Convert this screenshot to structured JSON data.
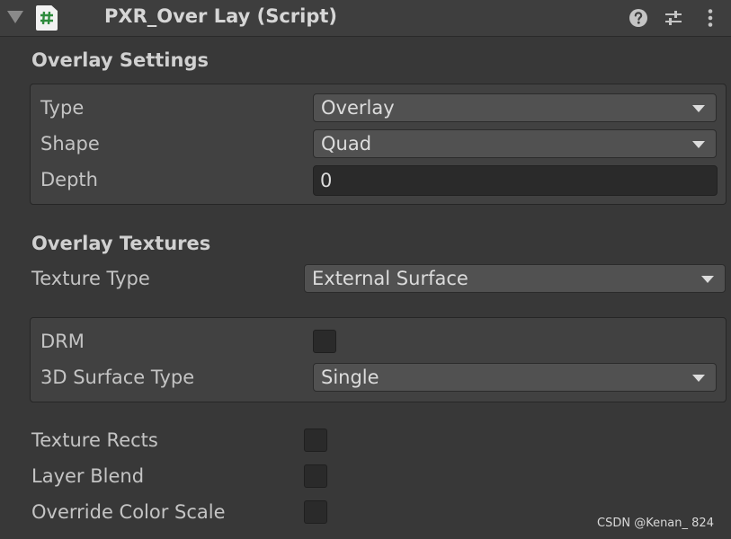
{
  "header": {
    "title": "PXR_Over Lay (Script)",
    "script_icon_glyph": "#",
    "icons": [
      "foldout-arrow-icon",
      "script-icon",
      "help-icon",
      "preset-sliders-icon",
      "kebab-menu-icon"
    ]
  },
  "overlay_settings": {
    "title": "Overlay Settings",
    "type_label": "Type",
    "type_value": "Overlay",
    "shape_label": "Shape",
    "shape_value": "Quad",
    "depth_label": "Depth",
    "depth_value": "0"
  },
  "overlay_textures": {
    "title": "Overlay Textures",
    "texture_type_label": "Texture Type",
    "texture_type_value": "External Surface",
    "drm_label": "DRM",
    "drm_checked": false,
    "surface_type_label": "3D Surface Type",
    "surface_type_value": "Single",
    "texture_rects_label": "Texture Rects",
    "texture_rects_checked": false,
    "layer_blend_label": "Layer Blend",
    "layer_blend_checked": false,
    "override_color_scale_label": "Override Color Scale",
    "override_color_scale_checked": false
  },
  "watermark": "CSDN @Kenan_ 824",
  "colors": {
    "background": "#383838",
    "header": "#3e3e3e",
    "group_box": "#414141",
    "dropdown": "#515151",
    "input": "#2a2a2a",
    "text": "#c8c8c8"
  }
}
